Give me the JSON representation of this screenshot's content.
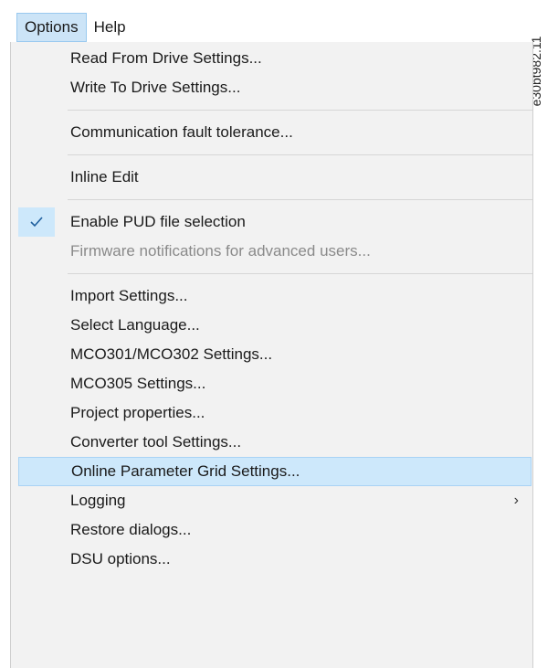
{
  "menubar": {
    "items": [
      {
        "label": "Options"
      },
      {
        "label": "Help"
      }
    ]
  },
  "figure_id": "e30bt982.11",
  "menu": {
    "items": [
      {
        "label": "Read From Drive Settings..."
      },
      {
        "label": "Write To Drive Settings..."
      },
      {
        "label": "Communication fault tolerance..."
      },
      {
        "label": "Inline Edit"
      },
      {
        "label": "Enable PUD file selection",
        "checked": true
      },
      {
        "label": "Firmware notifications for advanced users...",
        "disabled": true
      },
      {
        "label": "Import Settings..."
      },
      {
        "label": "Select Language..."
      },
      {
        "label": "MCO301/MCO302 Settings..."
      },
      {
        "label": "MCO305 Settings..."
      },
      {
        "label": "Project properties..."
      },
      {
        "label": "Converter tool Settings..."
      },
      {
        "label": "Online Parameter Grid Settings...",
        "highlighted": true
      },
      {
        "label": "Logging",
        "submenu_arrow": "›"
      },
      {
        "label": "Restore dialogs..."
      },
      {
        "label": "DSU options..."
      }
    ]
  },
  "colors": {
    "highlight": "#cde8fb",
    "menu_bg": "#f2f2f2",
    "disabled_text": "#8a8a8a"
  }
}
